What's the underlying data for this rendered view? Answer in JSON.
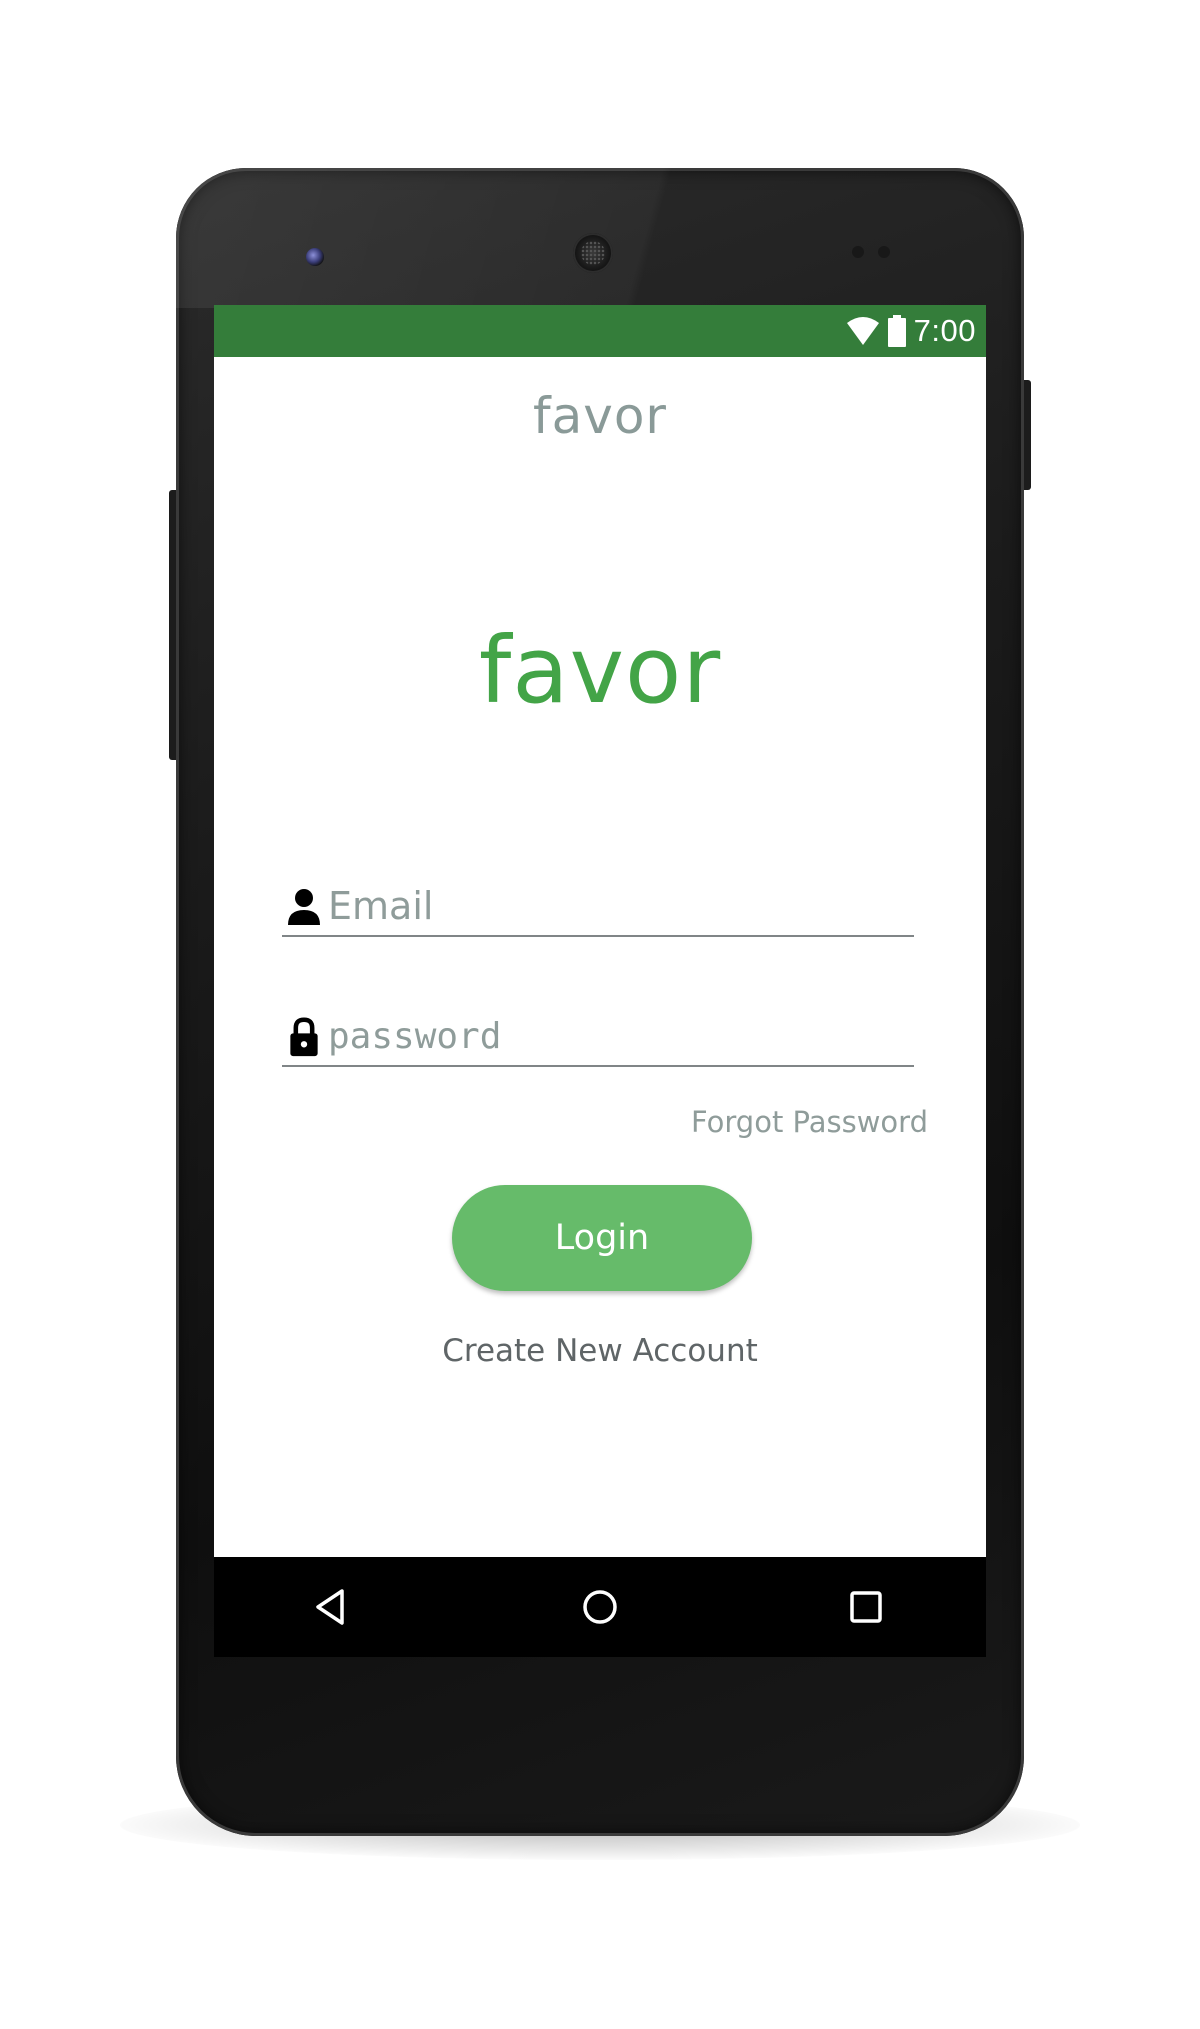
{
  "status_bar": {
    "time": "7:00",
    "wifi_icon": "wifi-icon",
    "battery_icon": "battery-icon"
  },
  "app": {
    "title": "favor",
    "logo_text": "favor"
  },
  "login_form": {
    "email": {
      "icon": "person-icon",
      "placeholder": "Email",
      "value": ""
    },
    "password": {
      "icon": "lock-icon",
      "placeholder": "password",
      "value": ""
    },
    "forgot_password_label": "Forgot Password",
    "login_label": "Login",
    "create_account_label": "Create New Account"
  },
  "nav_bar": {
    "back_icon": "back-triangle-icon",
    "home_icon": "home-circle-icon",
    "recents_icon": "recents-square-icon"
  },
  "colors": {
    "status_bar": "#347d3a",
    "brand_green": "#43a447",
    "login_button": "#66bb6a",
    "muted_text": "#8f9c9a"
  }
}
